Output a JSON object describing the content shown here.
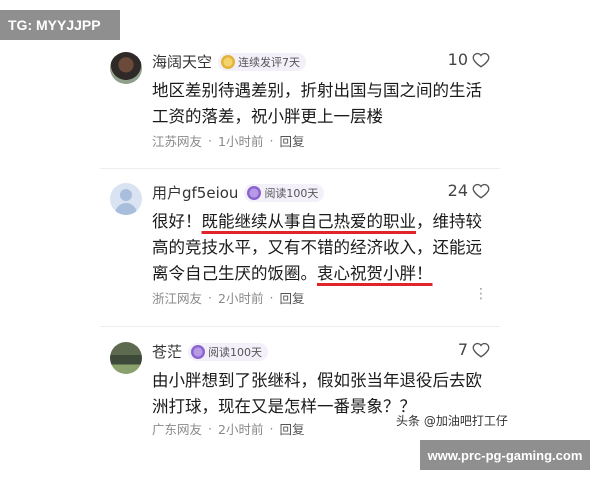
{
  "tag": "TG: MYYJJPP",
  "comments": [
    {
      "username": "海阔天空",
      "badge": "连续发评7天",
      "badge_color": "#e2b23a",
      "likes": "10",
      "text_before": "地区差别待遇差别，折射出国与国之间的生活工资的落差，祝小胖更上一层楼",
      "location": "江苏网友",
      "time": "1小时前",
      "reply": "回复"
    },
    {
      "username": "用户gf5eiou",
      "badge": "阅读100天",
      "badge_color": "#8a64cf",
      "likes": "24",
      "text_part1": "很好！",
      "text_hl1": "既能继续从事自己热爱的职业",
      "text_part2": "，维持较高的竞技水平，又有不错的经济收入，还能远离令自己生厌的饭圈。",
      "text_hl2": "衷心祝贺小胖！",
      "location": "浙江网友",
      "time": "2小时前",
      "reply": "回复"
    },
    {
      "username": "苍茫",
      "badge": "阅读100天",
      "badge_color": "#8a64cf",
      "likes": "7",
      "text_before": "由小胖想到了张继科，假如张当年退役后去欧洲打球，现在又是怎样一番景象？？",
      "location": "广东网友",
      "time": "2小时前",
      "reply": "回复"
    }
  ],
  "meta_separator": "·",
  "more_glyph": "⋮",
  "watermark_author": "头条 @加油吧打工仔",
  "watermark_site": "www.prc-pg-gaming.com",
  "accent_underline": "#e0242b"
}
